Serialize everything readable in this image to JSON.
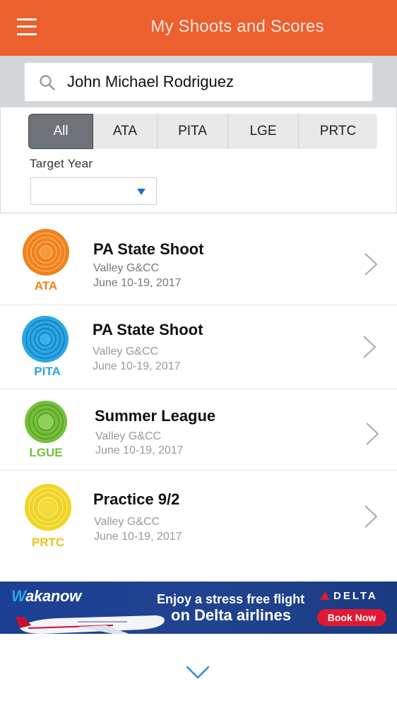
{
  "header": {
    "title": "My Shoots and Scores",
    "menu_icon": "hamburger-icon",
    "color": "#ec5f2e"
  },
  "search": {
    "value": "John Michael Rodriguez",
    "icon": "search-icon"
  },
  "filters": {
    "tabs": [
      {
        "label": "All",
        "active": true
      },
      {
        "label": "ATA",
        "active": false
      },
      {
        "label": "PITA",
        "active": false
      },
      {
        "label": "LGE",
        "active": false
      },
      {
        "label": "PRTC",
        "active": false
      }
    ],
    "target_year_label": "Target Year",
    "target_year_value": ""
  },
  "shoots": [
    {
      "badge": "ATA",
      "color": "#f0821e",
      "title": "PA State Shoot",
      "club": "Valley G&CC",
      "date": "June 10-19, 2017"
    },
    {
      "badge": "PITA",
      "color": "#2aa7e1",
      "title": "PA State Shoot",
      "club": "Valley G&CC",
      "date": "June 10-19, 2017"
    },
    {
      "badge": "LGUE",
      "color": "#76bf3b",
      "title": "Summer League",
      "club": "Valley G&CC",
      "date": "June 10-19, 2017"
    },
    {
      "badge": "PRTC",
      "color": "#efd422",
      "title": "Practice 9/2",
      "club": "Valley G&CC",
      "date": "June 10-19, 2017"
    }
  ],
  "ad": {
    "brand_w": "W",
    "brand_rest": "akanow",
    "line1": "Enjoy a stress free flight",
    "line2": "on Delta airlines",
    "airline": "DELTA",
    "cta": "Book Now"
  }
}
